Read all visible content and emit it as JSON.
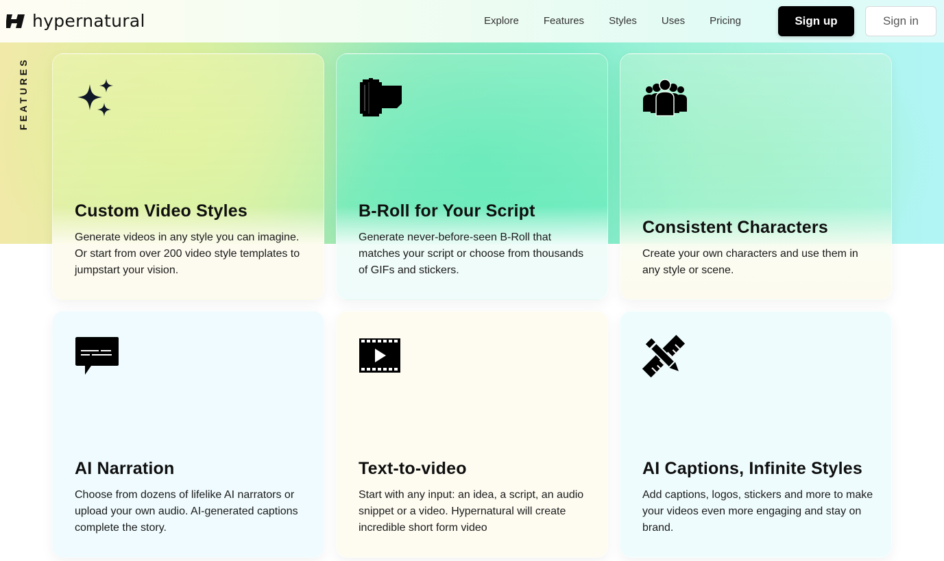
{
  "brand": {
    "name": "hypernatural"
  },
  "nav": {
    "links": [
      "Explore",
      "Features",
      "Styles",
      "Uses",
      "Pricing"
    ],
    "signup_label": "Sign up",
    "signin_label": "Sign in"
  },
  "section": {
    "label": "FEATURES"
  },
  "features": [
    {
      "icon": "sparkles-icon",
      "title": "Custom Video Styles",
      "description": "Generate videos in any style you can imagine. Or start from over 200 video style templates to jumpstart your vision."
    },
    {
      "icon": "film-roll-icon",
      "title": "B-Roll for Your Script",
      "description": "Generate never-before-seen B-Roll that matches your script or choose from thousands of GIFs and stickers."
    },
    {
      "icon": "people-group-icon",
      "title": "Consistent Characters",
      "description": "Create your own characters and use them in any style or scene."
    },
    {
      "icon": "speech-bubble-icon",
      "title": "AI Narration",
      "description": "Choose from dozens of lifelike AI narrators or upload your own audio. AI-generated captions complete the story."
    },
    {
      "icon": "film-play-icon",
      "title": "Text-to-video",
      "description": "Start with any input: an idea, a script, an audio snippet or a video. Hypernatural will create incredible short form video"
    },
    {
      "icon": "ruler-pencil-icon",
      "title": "AI Captions, Infinite Styles",
      "description": "Add captions, logos, stickers and more to make your videos even more engaging and stay on brand."
    }
  ]
}
